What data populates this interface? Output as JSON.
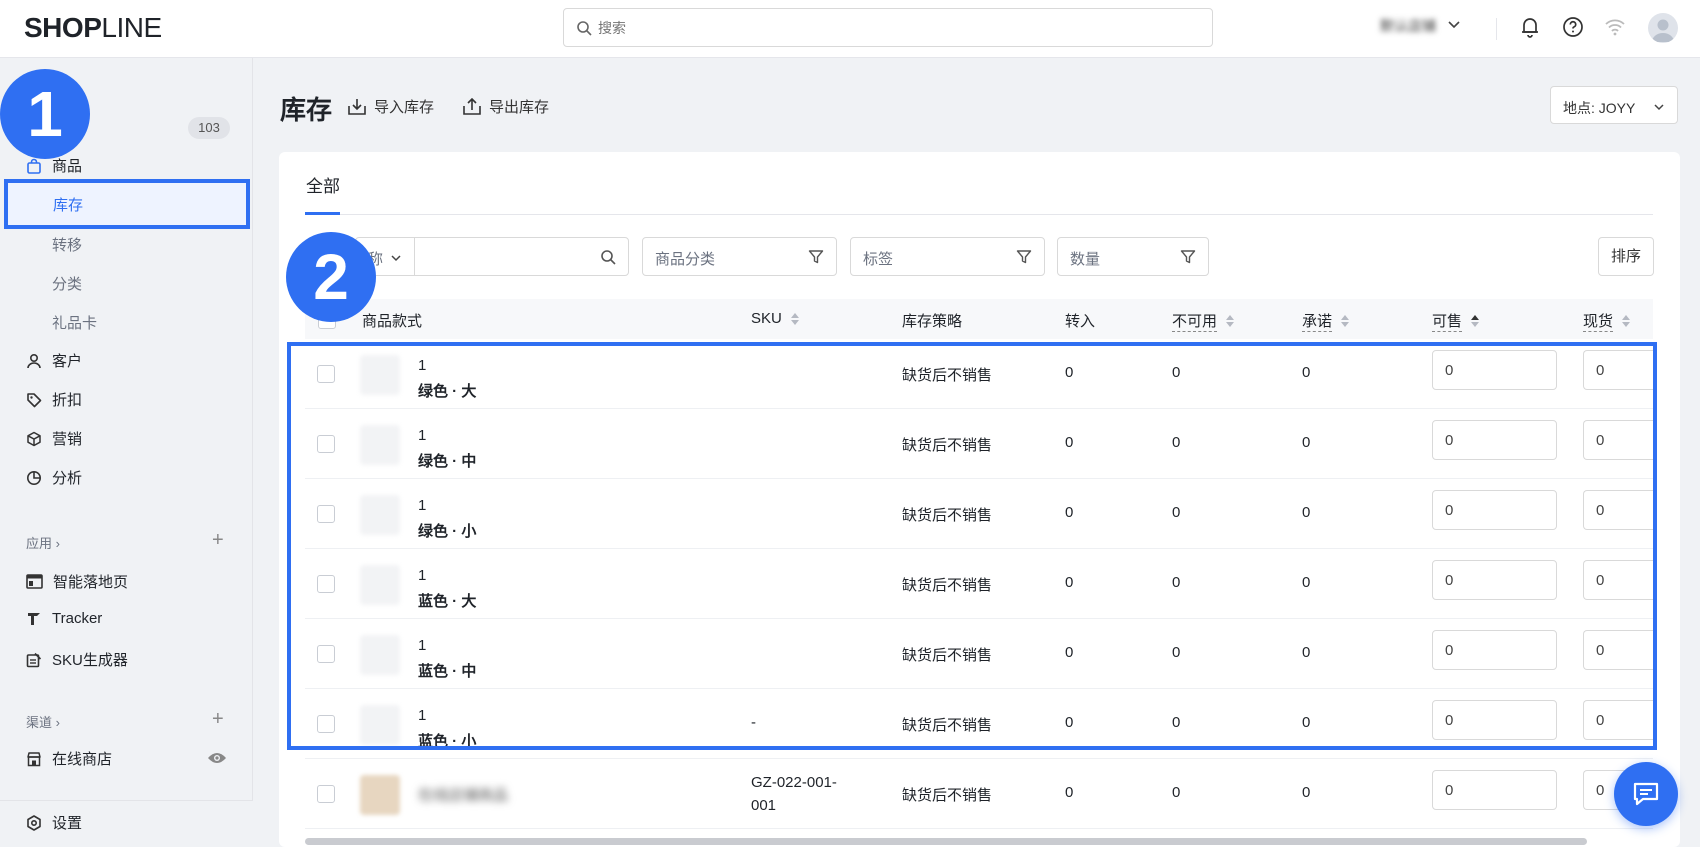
{
  "brand": {
    "logo": "SHOPLINE",
    "accent": "#2f6ff2"
  },
  "search": {
    "placeholder": "搜索"
  },
  "topbar": {
    "store_name": "默认店铺"
  },
  "sidebar": {
    "partial_top": "…",
    "badge": "103",
    "items": [
      {
        "label": "商品",
        "icon": "bag-icon"
      },
      {
        "label": "库存",
        "active": true
      },
      {
        "label": "转移"
      },
      {
        "label": "分类"
      },
      {
        "label": "礼品卡"
      },
      {
        "label": "客户",
        "icon": "user-icon"
      },
      {
        "label": "折扣",
        "icon": "tag-icon"
      },
      {
        "label": "营销",
        "icon": "cube-icon"
      },
      {
        "label": "分析",
        "icon": "pie-icon"
      }
    ],
    "apps_section": "应用",
    "apps": [
      {
        "label": "智能落地页",
        "icon": "layout-icon"
      },
      {
        "label": "Tracker",
        "icon": "tracker-icon"
      },
      {
        "label": "SKU生成器",
        "icon": "sku-icon"
      }
    ],
    "channels_section": "渠道",
    "channels": [
      {
        "label": "在线商店",
        "icon": "store-icon"
      }
    ],
    "settings": "设置"
  },
  "markers": {
    "one": "1",
    "two": "2"
  },
  "page": {
    "title": "库存",
    "import": "导入库存",
    "export": "导出库存",
    "location": "地点: JOYY"
  },
  "tabs": {
    "all": "全部"
  },
  "filters": {
    "name_select": "称",
    "category": "商品分类",
    "tags": "标签",
    "quantity": "数量",
    "sort": "排序"
  },
  "table": {
    "headers": {
      "product": "商品款式",
      "sku": "SKU",
      "policy": "库存策略",
      "transfer_in": "转入",
      "unavailable": "不可用",
      "committed": "承诺",
      "available": "可售",
      "on_hand": "现货"
    },
    "rows": [
      {
        "name": "1",
        "variant": "绿色 · 大",
        "sku": "",
        "policy": "缺货后不销售",
        "transfer_in": "0",
        "unavailable": "0",
        "committed": "0",
        "available": "0",
        "on_hand": "0"
      },
      {
        "name": "1",
        "variant": "绿色 · 中",
        "sku": "",
        "policy": "缺货后不销售",
        "transfer_in": "0",
        "unavailable": "0",
        "committed": "0",
        "available": "0",
        "on_hand": "0"
      },
      {
        "name": "1",
        "variant": "绿色 · 小",
        "sku": "",
        "policy": "缺货后不销售",
        "transfer_in": "0",
        "unavailable": "0",
        "committed": "0",
        "available": "0",
        "on_hand": "0"
      },
      {
        "name": "1",
        "variant": "蓝色 · 大",
        "sku": "",
        "policy": "缺货后不销售",
        "transfer_in": "0",
        "unavailable": "0",
        "committed": "0",
        "available": "0",
        "on_hand": "0"
      },
      {
        "name": "1",
        "variant": "蓝色 · 中",
        "sku": "",
        "policy": "缺货后不销售",
        "transfer_in": "0",
        "unavailable": "0",
        "committed": "0",
        "available": "0",
        "on_hand": "0"
      },
      {
        "name": "1",
        "variant": "蓝色 · 小",
        "sku": "-",
        "policy": "缺货后不销售",
        "transfer_in": "0",
        "unavailable": "0",
        "committed": "0",
        "available": "0",
        "on_hand": "0"
      },
      {
        "name": "在线店铺商品",
        "variant": "",
        "sku": "GZ-022-001-\n001",
        "policy": "缺货后不销售",
        "transfer_in": "0",
        "unavailable": "0",
        "committed": "0",
        "available": "0",
        "on_hand": "0"
      }
    ]
  }
}
